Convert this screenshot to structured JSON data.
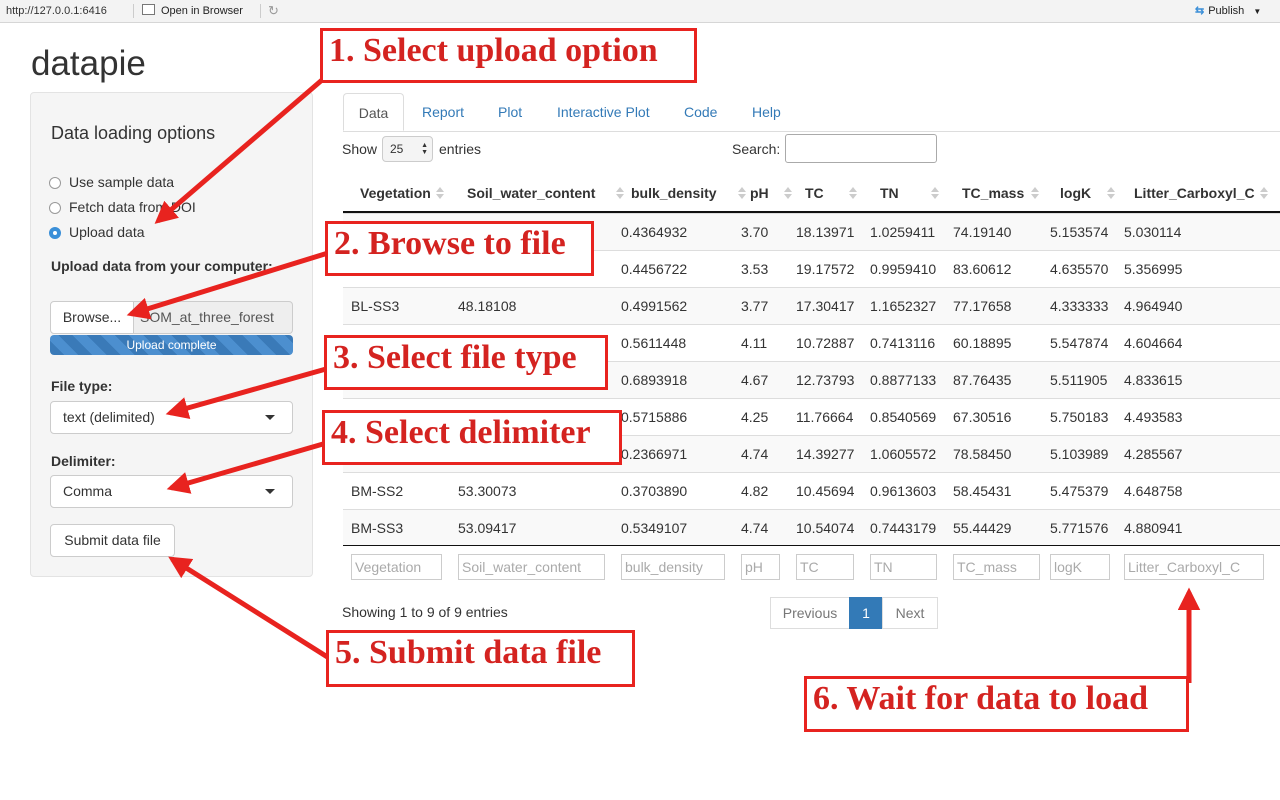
{
  "viewer_bar": {
    "url": "http://127.0.0.1:6416",
    "open_in_browser": "Open in Browser",
    "publish": "Publish"
  },
  "app": {
    "title": "datapie"
  },
  "sidebar": {
    "title": "Data loading options",
    "options": [
      {
        "label": "Use sample data",
        "checked": false
      },
      {
        "label": "Fetch data from DOI",
        "checked": false
      },
      {
        "label": "Upload data",
        "checked": true
      }
    ],
    "upload_label": "Upload data from your computer:",
    "browse_label": "Browse...",
    "file_name": "SOM_at_three_forest",
    "progress_text": "Upload complete",
    "file_type_label": "File type:",
    "file_type_value": "text (delimited)",
    "delimiter_label": "Delimiter:",
    "delimiter_value": "Comma",
    "submit_label": "Submit data file"
  },
  "tabs": [
    {
      "label": "Data",
      "active": true
    },
    {
      "label": "Report",
      "active": false
    },
    {
      "label": "Plot",
      "active": false
    },
    {
      "label": "Interactive Plot",
      "active": false
    },
    {
      "label": "Code",
      "active": false
    },
    {
      "label": "Help",
      "active": false
    }
  ],
  "table_controls": {
    "show_label": "Show",
    "page_length": "25",
    "entries_label": "entries",
    "search_label": "Search:"
  },
  "table": {
    "columns": [
      "Vegetation",
      "Soil_water_content",
      "bulk_density",
      "pH",
      "TC",
      "TN",
      "TC_mass",
      "logK",
      "Litter_Carboxyl_C"
    ],
    "rows": [
      [
        "",
        "",
        "0.4364932",
        "3.70",
        "18.13971",
        "1.0259411",
        "74.19140",
        "5.153574",
        "5.030114"
      ],
      [
        "",
        "",
        "0.4456722",
        "3.53",
        "19.17572",
        "0.9959410",
        "83.60612",
        "4.635570",
        "5.356995"
      ],
      [
        "BL-SS3",
        "48.18108",
        "0.4991562",
        "3.77",
        "17.30417",
        "1.1652327",
        "77.17658",
        "4.333333",
        "4.964940"
      ],
      [
        "",
        "",
        "0.5611448",
        "4.11",
        "10.72887",
        "0.7413116",
        "60.18895",
        "5.547874",
        "4.604664"
      ],
      [
        "",
        "",
        "0.6893918",
        "4.67",
        "12.73793",
        "0.8877133",
        "87.76435",
        "5.511905",
        "4.833615"
      ],
      [
        "",
        "",
        "0.5715886",
        "4.25",
        "11.76664",
        "0.8540569",
        "67.30516",
        "5.750183",
        "4.493583"
      ],
      [
        "",
        "",
        "0.2366971",
        "4.74",
        "14.39277",
        "1.0605572",
        "78.58450",
        "5.103989",
        "4.285567"
      ],
      [
        "BM-SS2",
        "53.30073",
        "0.3703890",
        "4.82",
        "10.45694",
        "0.9613603",
        "58.45431",
        "5.475379",
        "4.648758"
      ],
      [
        "BM-SS3",
        "53.09417",
        "0.5349107",
        "4.74",
        "10.54074",
        "0.7443179",
        "55.44429",
        "5.771576",
        "4.880941"
      ]
    ]
  },
  "footer": {
    "info": "Showing 1 to 9 of 9 entries",
    "previous": "Previous",
    "current_page": "1",
    "next": "Next"
  },
  "annotations": [
    "1. Select upload option",
    "2. Browse to file",
    "3. Select file type",
    "4. Select delimiter",
    "5. Submit data file",
    "6. Wait for data to load"
  ]
}
